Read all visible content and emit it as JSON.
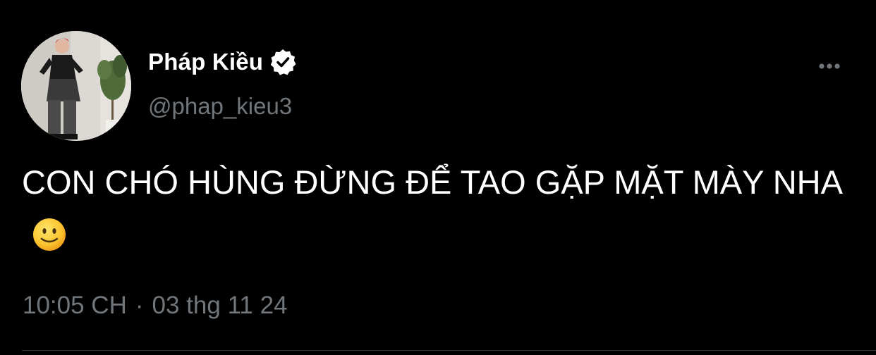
{
  "author": {
    "display_name": "Pháp Kiều",
    "handle": "@phap_kieu3",
    "verified_icon": "verified-badge-icon",
    "avatar": "profile-photo"
  },
  "menu": {
    "icon": "more-options-icon"
  },
  "tweet": {
    "text": "CON CHÓ HÙNG ĐỪNG ĐỂ TAO GẶP MẶT MÀY NHA",
    "emoji": "slightly-smiling-face-icon"
  },
  "meta": {
    "time": "10:05 CH",
    "separator": "·",
    "date": "03 thg 11 24"
  },
  "colors": {
    "background": "#000000",
    "primary_text": "#ffffff",
    "secondary_text": "#71767b",
    "divider": "#2f3336"
  }
}
